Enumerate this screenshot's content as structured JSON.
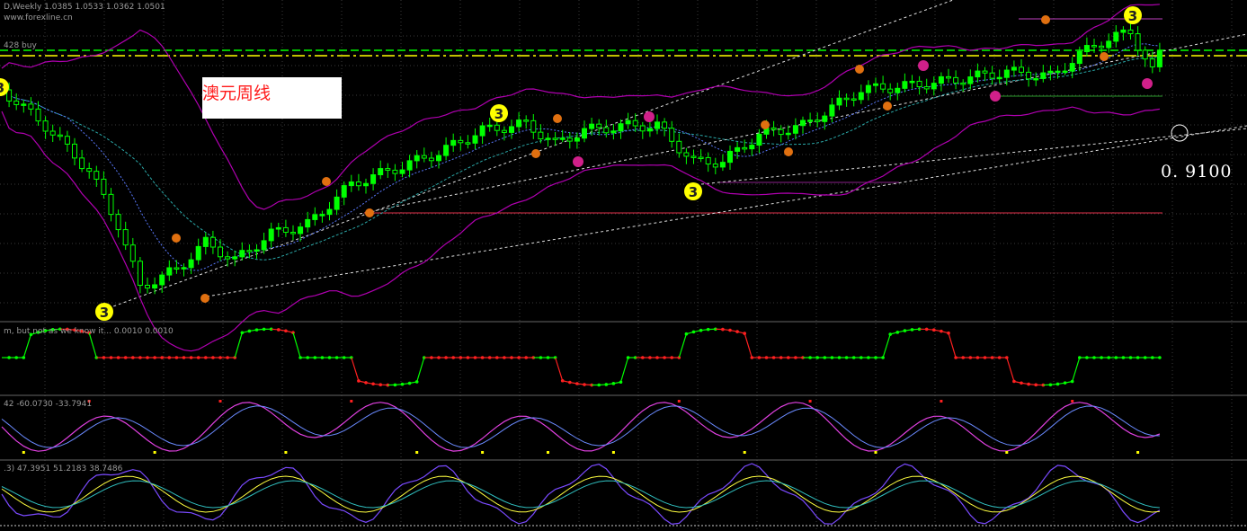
{
  "header": {
    "symbol_line": "D,Weekly  1.0385 1.0533 1.0362 1.0501",
    "site": "www.forexline.cn",
    "order_label": "428 buy",
    "ind1_label": "m, but not as we know it...  0.0010 0.0010",
    "ind2_label": "42 -60.0730 -33.7941",
    "ind3_label": ".3) 47.3951 51.2183 38.7486"
  },
  "annotations": {
    "title": "澳元周线",
    "price_level": "0. 9100",
    "wave_marker": "3"
  },
  "colors": {
    "bull": "#00ff00",
    "bear": "#00ff00",
    "band": "#b000b0",
    "level_green": "#00ff00",
    "level_yellow": "#ffff00",
    "marker_yellow": "#ffff00",
    "marker_orange": "#e07010",
    "marker_magenta": "#d0208a"
  },
  "chart_data": {
    "type": "candlestick",
    "timeframe": "Weekly",
    "last_bar": {
      "open": 1.0385,
      "high": 1.0533,
      "low": 1.0362,
      "close": 1.0501
    },
    "levels": [
      {
        "label": "0. 9100",
        "value": 0.91
      }
    ],
    "wave_labels": [
      "3",
      "3",
      "3",
      "3"
    ],
    "panels": [
      "price",
      "oscillator",
      "stochastic",
      "rsi"
    ]
  }
}
